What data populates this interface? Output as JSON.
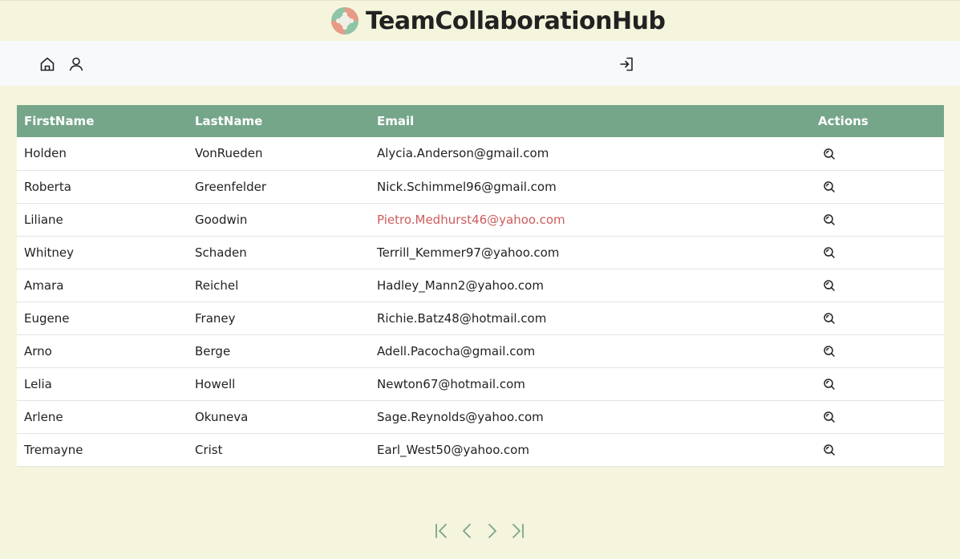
{
  "app": {
    "title": "TeamCollaborationHub"
  },
  "navbar": {
    "icons": [
      "home-icon",
      "user-icon",
      "login-icon"
    ]
  },
  "table": {
    "headers": {
      "first": "FirstName",
      "last": "LastName",
      "email": "Email",
      "actions": "Actions"
    },
    "rows": [
      {
        "first": "Holden",
        "last": "VonRueden",
        "email": "Alycia.Anderson@gmail.com"
      },
      {
        "first": "Roberta",
        "last": "Greenfelder",
        "email": "Nick.Schimmel96@gmail.com"
      },
      {
        "first": "Liliane",
        "last": "Goodwin",
        "email": "Pietro.Medhurst46@yahoo.com"
      },
      {
        "first": "Whitney",
        "last": "Schaden",
        "email": "Terrill_Kemmer97@yahoo.com"
      },
      {
        "first": "Amara",
        "last": "Reichel",
        "email": "Hadley_Mann2@yahoo.com"
      },
      {
        "first": "Eugene",
        "last": "Franey",
        "email": "Richie.Batz48@hotmail.com"
      },
      {
        "first": "Arno",
        "last": "Berge",
        "email": "Adell.Pacocha@gmail.com"
      },
      {
        "first": "Lelia",
        "last": "Howell",
        "email": "Newton67@hotmail.com"
      },
      {
        "first": "Arlene",
        "last": "Okuneva",
        "email": "Sage.Reynolds@yahoo.com"
      },
      {
        "first": "Tremayne",
        "last": "Crist",
        "email": "Earl_West50@yahoo.com"
      }
    ],
    "row_action_icon": "search-icon"
  },
  "pagination": {
    "icons": [
      "first-page-icon",
      "previous-page-icon",
      "next-page-icon",
      "last-page-icon"
    ]
  },
  "colors": {
    "background": "#f5f4dc",
    "navbar": "#f8f9fa",
    "header_row": "#76a68a",
    "pager": "#76a68a",
    "link_highlight": "#cd5c5c"
  }
}
